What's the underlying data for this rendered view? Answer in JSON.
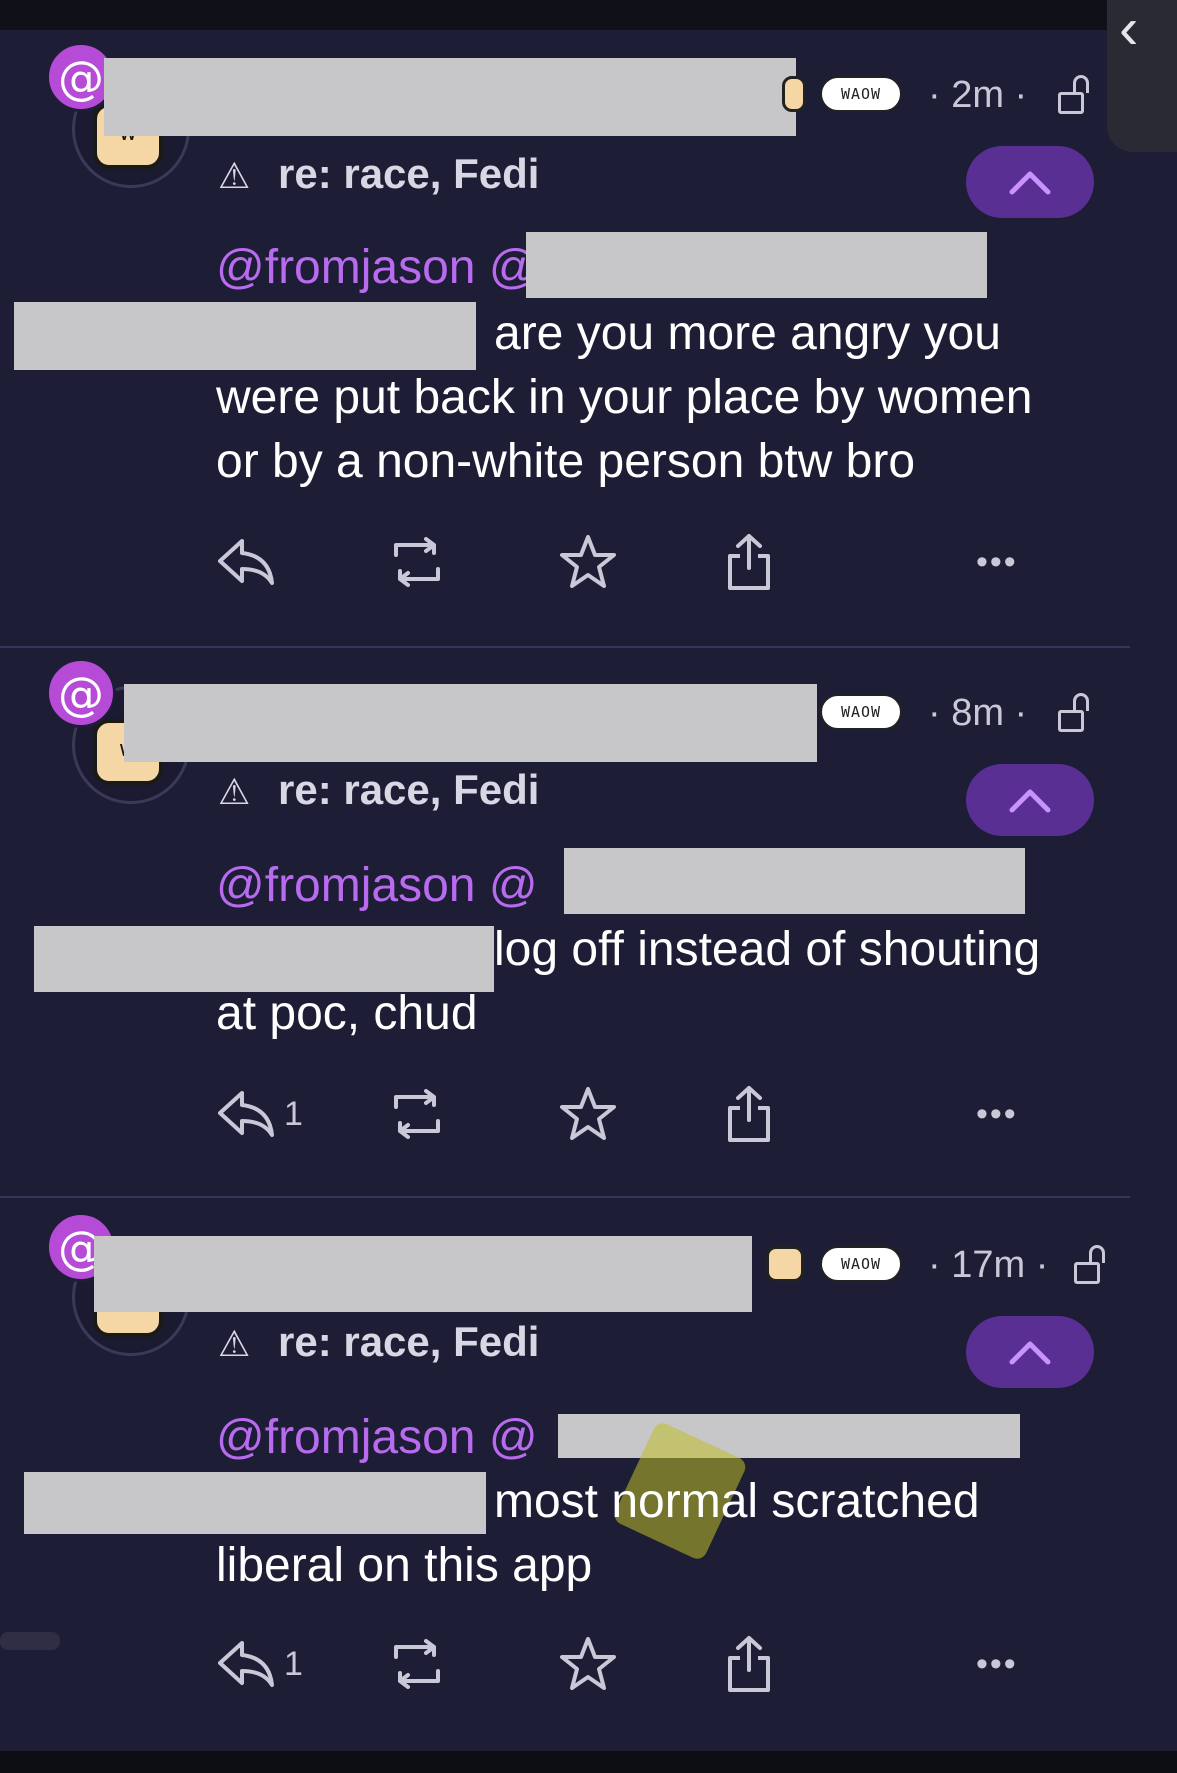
{
  "posts": [
    {
      "time": "· 2m ·",
      "cw": "re: race, Fedi",
      "mention": "@fromjason @",
      "line2": "are you more angry you",
      "line3": "were put back in your place by women",
      "line4": "or by a non-white person btw bro",
      "reply_count": ""
    },
    {
      "time": "· 8m ·",
      "cw": "re: race, Fedi",
      "mention": "@fromjason @",
      "line2": "log off instead of shouting",
      "line3": "at poc, chud",
      "line4": "",
      "reply_count": "1"
    },
    {
      "time": "· 17m ·",
      "cw": "re: race, Fedi",
      "mention": "@fromjason @",
      "line2": "most normal scratched",
      "line3": "liberal on this app",
      "line4": "",
      "reply_count": "1"
    }
  ],
  "icons": {
    "badge": "@",
    "emoji_text": "WAOW",
    "more": "•••",
    "side_chevron": "‹"
  },
  "colors": {
    "background": "#1e1d36",
    "mention": "#b86bef",
    "accent_button": "#5a2f94",
    "badge": "#b64bd8"
  }
}
